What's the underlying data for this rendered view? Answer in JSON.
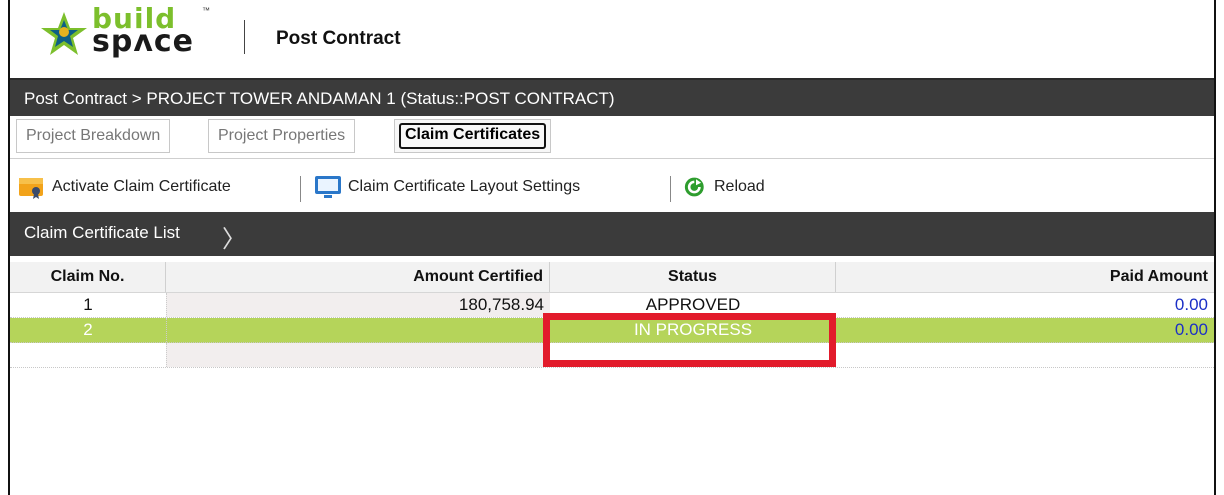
{
  "header": {
    "logo_line1": "build",
    "logo_line2": "spʌce",
    "logo_tm": "™",
    "title": "Post Contract"
  },
  "breadcrumb": "Post Contract > PROJECT TOWER ANDAMAN 1 (Status::POST CONTRACT)",
  "tabs": [
    {
      "label": "Project Breakdown",
      "active": false
    },
    {
      "label": "Project Properties",
      "active": false
    },
    {
      "label": "Claim Certificates",
      "active": true
    }
  ],
  "toolbar": {
    "activate_label": "Activate Claim Certificate",
    "layout_label": "Claim Certificate Layout Settings",
    "reload_label": "Reload"
  },
  "list_bar": {
    "title": "Claim Certificate List",
    "chevron": "〉"
  },
  "table": {
    "columns": [
      "Claim No.",
      "Amount Certified",
      "Status",
      "Paid Amount"
    ],
    "rows": [
      {
        "claim_no": "1",
        "amount_certified": "180,758.94",
        "status": "APPROVED",
        "paid_amount": "0.00"
      },
      {
        "claim_no": "2",
        "amount_certified": "",
        "status": "IN PROGRESS",
        "paid_amount": "0.00"
      }
    ],
    "selected_row": 2
  },
  "colors": {
    "dark_bar": "#3b3b3b",
    "selected_row": "#b5d45a",
    "link_blue": "#1b2fc6",
    "highlight_red": "#e21b2b",
    "logo_green": "#7cbf2c"
  }
}
